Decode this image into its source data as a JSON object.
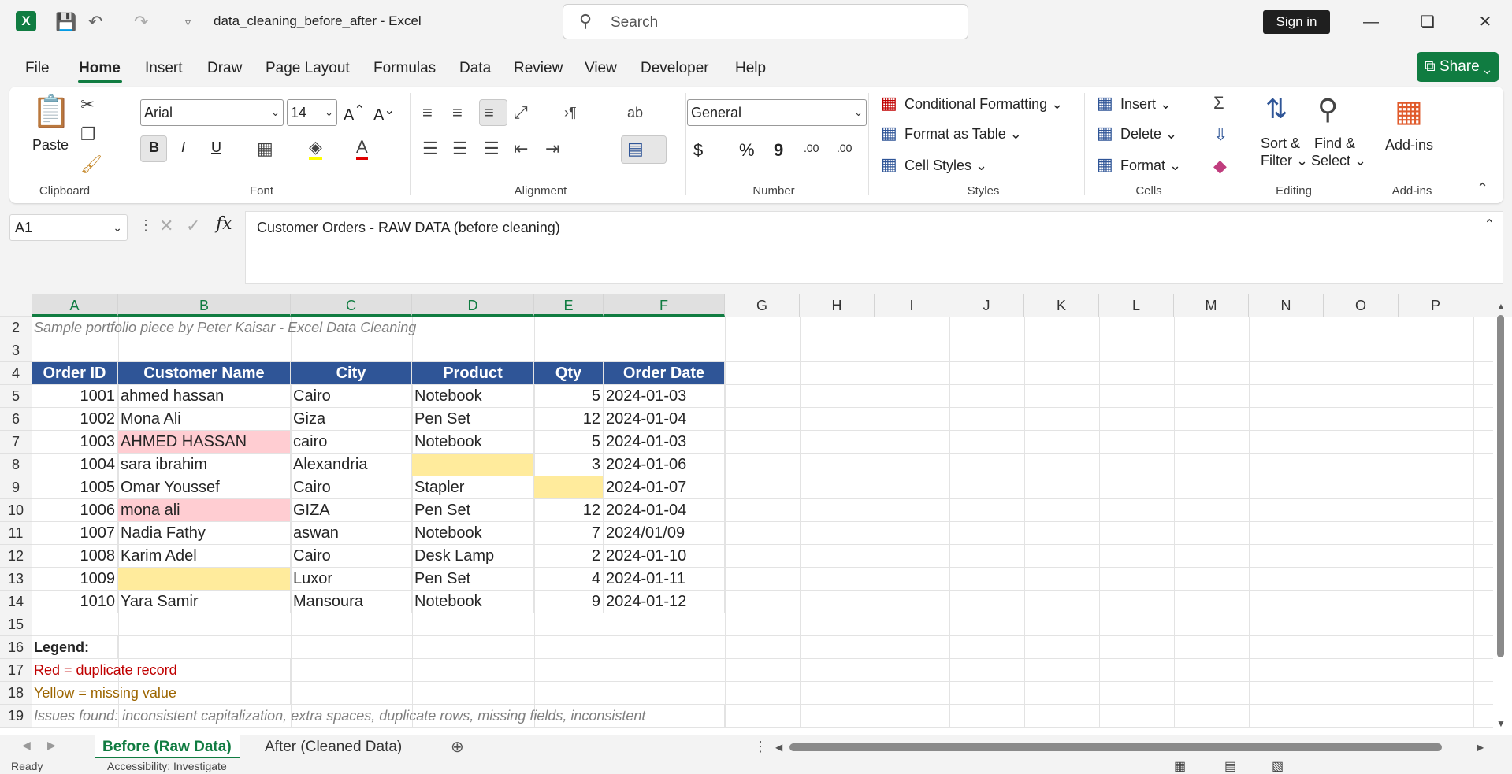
{
  "app": {
    "doc_title": "data_cleaning_before_after  -  Excel",
    "search_placeholder": "Search",
    "sign_in": "Sign in",
    "share": "Share"
  },
  "menu": [
    "File",
    "Home",
    "Insert",
    "Draw",
    "Page Layout",
    "Formulas",
    "Data",
    "Review",
    "View",
    "Developer",
    "Help"
  ],
  "ribbon": {
    "clipboard": {
      "paste": "Paste",
      "label": "Clipboard"
    },
    "font": {
      "name": "Arial",
      "size": "14",
      "bold": "B",
      "italic": "I",
      "underline": "U",
      "label": "Font"
    },
    "alignment": {
      "label": "Alignment"
    },
    "number": {
      "format": "General",
      "currency": "$",
      "percent": "%",
      "comma": "9",
      "inc": ".00",
      "dec": ".00",
      "label": "Number"
    },
    "styles": {
      "conditional": "Conditional Formatting",
      "table": "Format as Table",
      "cell_styles": "Cell Styles",
      "label": "Styles"
    },
    "cells": {
      "insert": "Insert",
      "delete": "Delete",
      "format": "Format",
      "label": "Cells"
    },
    "editing": {
      "sort1": "Sort &",
      "sort2": "Filter",
      "find1": "Find &",
      "find2": "Select",
      "label": "Editing"
    },
    "addins": {
      "btn": "Add-ins",
      "label": "Add-ins"
    }
  },
  "formula_bar": {
    "name_box": "A1",
    "fx": "fx",
    "content": "Customer Orders - RAW DATA (before cleaning)"
  },
  "columns": [
    "A",
    "B",
    "C",
    "D",
    "E",
    "F",
    "G",
    "H",
    "I",
    "J",
    "K",
    "L",
    "M",
    "N",
    "O",
    "P"
  ],
  "rows": [
    "2",
    "3",
    "4",
    "5",
    "6",
    "7",
    "8",
    "9",
    "10",
    "11",
    "12",
    "13",
    "14",
    "15",
    "16",
    "17",
    "18",
    "19"
  ],
  "sheet": {
    "subtitle": "Sample portfolio piece by Peter Kaisar - Excel Data Cleaning",
    "headers": [
      "Order ID",
      "Customer Name",
      "City",
      "Product",
      "Qty",
      "Order Date"
    ],
    "data": [
      [
        "1001",
        "ahmed hassan",
        " Cairo",
        "Notebook",
        "5",
        "2024-01-03"
      ],
      [
        "1002",
        "Mona Ali",
        "Giza",
        "Pen Set",
        "12",
        "2024-01-04"
      ],
      [
        "1003",
        "AHMED HASSAN",
        "cairo",
        "Notebook",
        "5",
        "2024-01-03"
      ],
      [
        "1004",
        "sara ibrahim",
        "Alexandria",
        "",
        "3",
        "2024-01-06"
      ],
      [
        "1005",
        "Omar   Youssef",
        "Cairo",
        "Stapler",
        "",
        "2024-01-07"
      ],
      [
        "1006",
        "mona ali",
        "GIZA",
        "Pen Set",
        "12",
        "2024-01-04"
      ],
      [
        "1007",
        "Nadia Fathy",
        "aswan",
        "Notebook",
        "7",
        "2024/01/09"
      ],
      [
        "1008",
        "Karim Adel",
        "Cairo",
        "Desk Lamp",
        "2",
        "2024-01-10"
      ],
      [
        "1009",
        "",
        "Luxor",
        "Pen Set",
        "4",
        "2024-01-11"
      ],
      [
        "1010",
        "Yara Samir",
        "Mansoura",
        "Notebook",
        "9",
        "2024-01-12"
      ]
    ],
    "legend_title": "Legend:",
    "legend_red": "Red = duplicate record",
    "legend_yellow": "Yellow = missing value",
    "issues": "Issues found: inconsistent capitalization, extra spaces, duplicate rows, missing fields, inconsistent"
  },
  "sheet_tabs": [
    "Before (Raw Data)",
    "After (Cleaned Data)"
  ],
  "status": {
    "ready": "Ready",
    "accessibility": "Accessibility: Investigate"
  },
  "colors": {
    "accent": "#107c41",
    "header": "#2f5597",
    "duplicate": "#ffcdd2",
    "missing": "#ffeb9c"
  }
}
